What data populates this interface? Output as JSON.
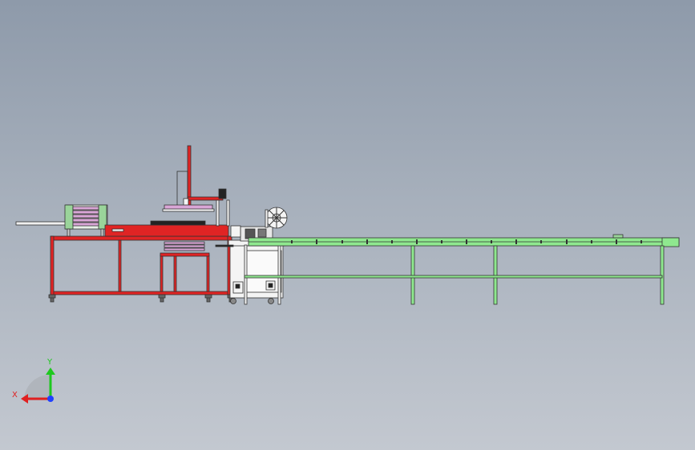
{
  "triad": {
    "x_label": "X",
    "y_label": "Y"
  },
  "colors": {
    "background_top": "#8e9aaa",
    "background_bottom": "#c3c8d0",
    "frame_red": "#e02424",
    "conveyor_green": "#8fe88f",
    "stack_pink": "#d9a6d6",
    "machine_white": "#f4f4f4",
    "outline": "#333333",
    "axis_x": "#e02020",
    "axis_y": "#1ec81e",
    "axis_z": "#2040ff"
  }
}
